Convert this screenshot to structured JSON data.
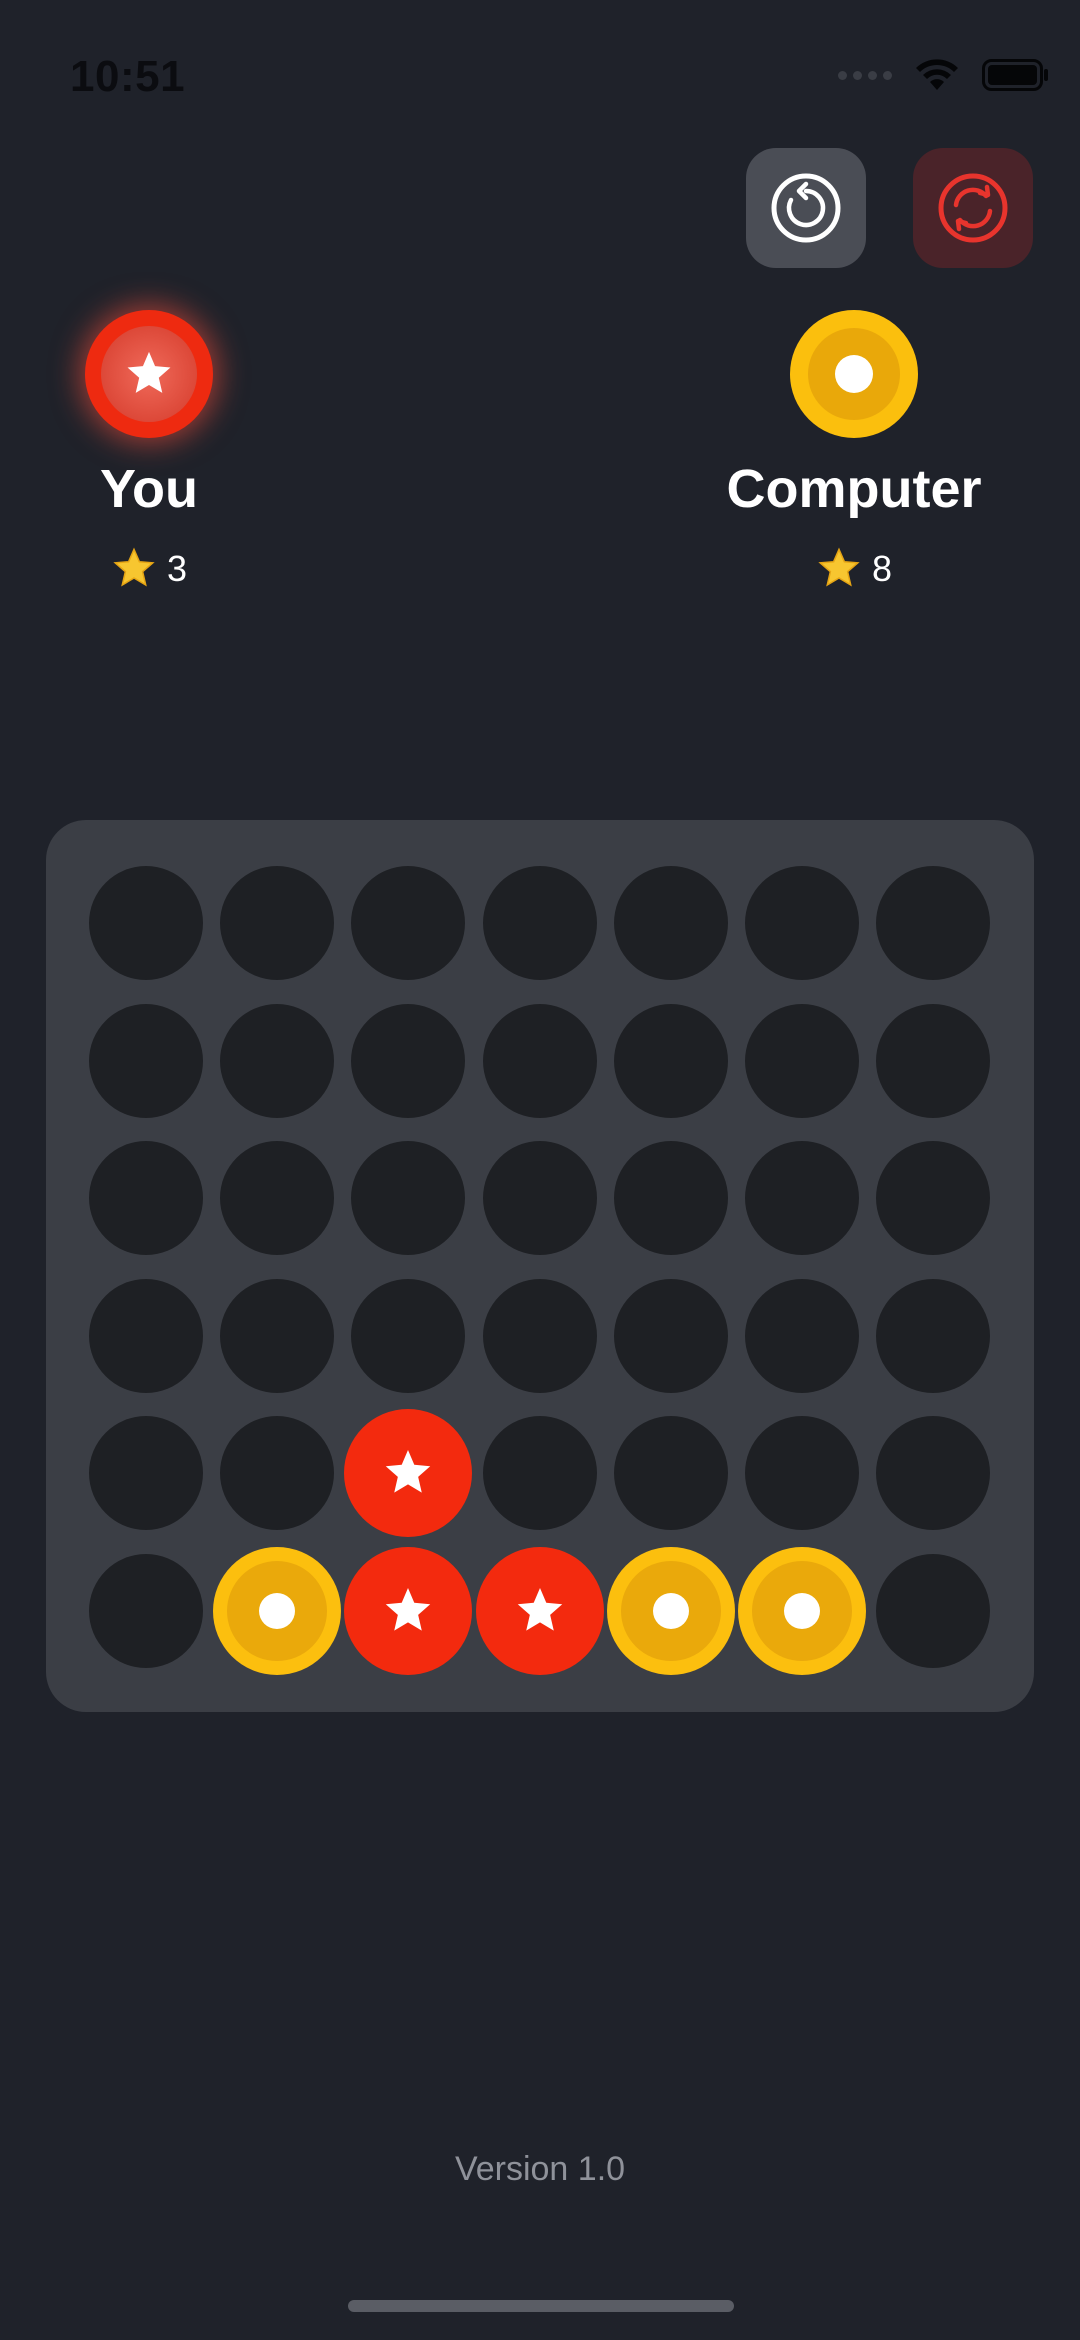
{
  "status_bar": {
    "time": "10:51"
  },
  "toolbar": {
    "undo_icon": "undo-icon",
    "restart_icon": "restart-icon",
    "restart_color": "#e8342d"
  },
  "players": {
    "you": {
      "name": "You",
      "score": "3",
      "token": "red-star"
    },
    "computer": {
      "name": "Computer",
      "score": "8",
      "token": "yellow-dot"
    }
  },
  "board": {
    "columns": 7,
    "rows": 6,
    "colors": {
      "red": "#f32a0e",
      "yellow": "#fcbf0e",
      "empty": "#1e2024"
    },
    "cells": [
      [
        null,
        null,
        null,
        null,
        null,
        null,
        null
      ],
      [
        null,
        null,
        null,
        null,
        null,
        null,
        null
      ],
      [
        null,
        null,
        null,
        null,
        null,
        null,
        null
      ],
      [
        null,
        null,
        null,
        null,
        null,
        null,
        null
      ],
      [
        null,
        null,
        "red",
        null,
        null,
        null,
        null
      ],
      [
        null,
        "yellow",
        "red",
        "red",
        "yellow",
        "yellow",
        null
      ]
    ]
  },
  "footer": {
    "version": "Version 1.0"
  }
}
